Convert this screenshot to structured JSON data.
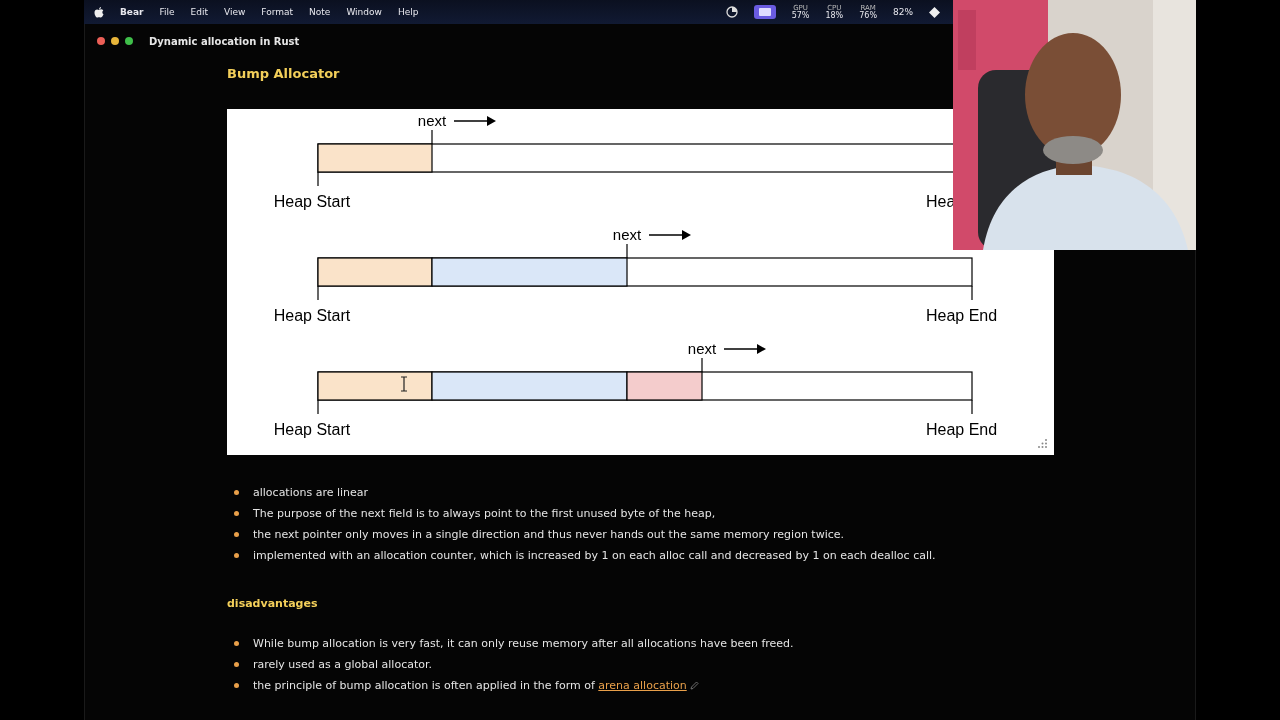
{
  "menu_bar": {
    "app": "Bear",
    "menus": [
      "File",
      "Edit",
      "View",
      "Format",
      "Note",
      "Window",
      "Help"
    ],
    "stats": [
      {
        "label": "GPU",
        "value": "57%"
      },
      {
        "label": "CPU",
        "value": "18%"
      },
      {
        "label": "RAM",
        "value": "76%"
      }
    ],
    "battery": "82%"
  },
  "window": {
    "title": "Dynamic allocation in Rust"
  },
  "heading": "Bump Allocator",
  "diagram": {
    "rows": [
      {
        "pointer_label": "next",
        "start_label": "Heap Start",
        "end_label": "Hea",
        "segments": [
          {
            "color": "#fae3c9"
          }
        ]
      },
      {
        "pointer_label": "next",
        "start_label": "Heap Start",
        "end_label": "Heap End",
        "segments": [
          {
            "color": "#fae3c9"
          },
          {
            "color": "#dae7f8"
          }
        ]
      },
      {
        "pointer_label": "next",
        "start_label": "Heap Start",
        "end_label": "Heap End",
        "segments": [
          {
            "color": "#fae3c9"
          },
          {
            "color": "#dae7f8"
          },
          {
            "color": "#f4cccc"
          }
        ]
      }
    ]
  },
  "bullets": [
    {
      "text": "allocations are linear"
    },
    {
      "text": "The purpose of the next field is to always point to the first unused byte of the heap,"
    },
    {
      "text": "the next pointer only moves in a single direction and thus never hands out the same memory region twice."
    },
    {
      "text": "implemented with an allocation counter, which is increased by 1 on each alloc call and decreased by 1 on each dealloc call."
    }
  ],
  "subheading": "disadvantages",
  "disadvantages": [
    {
      "text": "While bump allocation is very fast, it can only reuse memory after all allocations have been freed."
    },
    {
      "text": "rarely used as a global allocator."
    },
    {
      "text": "the principle of bump allocation is often applied in the form of ",
      "link": "arena allocation"
    }
  ]
}
